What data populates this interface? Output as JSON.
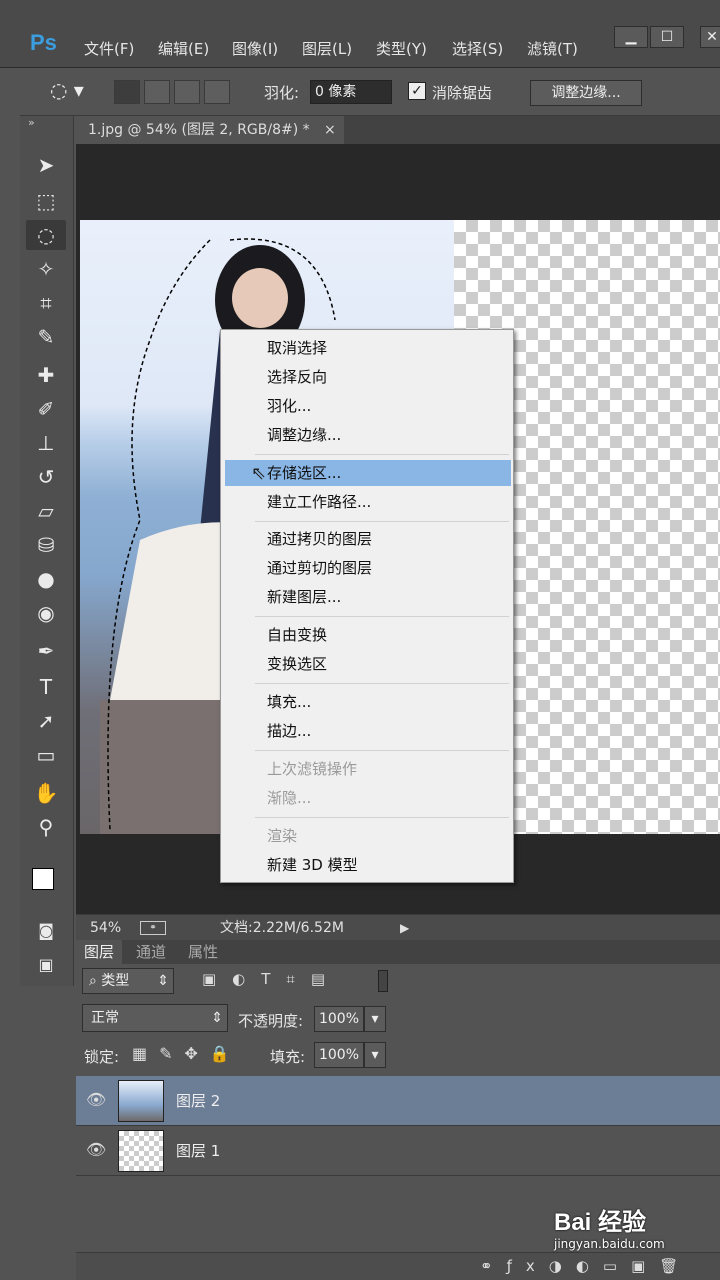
{
  "app": {
    "logo": "Ps"
  },
  "menu": {
    "items": [
      "文件(F)",
      "编辑(E)",
      "图像(I)",
      "图层(L)",
      "类型(Y)",
      "选择(S)",
      "滤镜(T)"
    ],
    "window_buttons": [
      "▁",
      "☐",
      "✕"
    ]
  },
  "options": {
    "feather_label": "羽化:",
    "feather_value": "0 像素",
    "antialias_label": "消除锯齿",
    "antialias_checked": true,
    "refine_edge_label": "调整边缘..."
  },
  "document_tab": {
    "title": "1.jpg @ 54% (图层 2, RGB/8#) *",
    "close": "×"
  },
  "toolbox": {
    "icons": [
      "move-icon",
      "marquee-icon",
      "lasso-icon",
      "magic-wand-icon",
      "crop-icon",
      "eyedropper-icon",
      "healing-brush-icon",
      "brush-icon",
      "clone-stamp-icon",
      "history-brush-icon",
      "eraser-icon",
      "paint-bucket-icon",
      "blur-icon",
      "dodge-icon",
      "pen-icon",
      "type-icon",
      "path-selection-icon",
      "rectangle-icon",
      "hand-icon",
      "zoom-icon"
    ],
    "active": "lasso-icon"
  },
  "context_menu": {
    "groups": [
      [
        "取消选择",
        "选择反向",
        "羽化...",
        "调整边缘..."
      ],
      [
        "存储选区...",
        "建立工作路径..."
      ],
      [
        "通过拷贝的图层",
        "通过剪切的图层",
        "新建图层..."
      ],
      [
        "自由变换",
        "变换选区"
      ],
      [
        "填充...",
        "描边..."
      ],
      [
        "上次滤镜操作",
        "渐隐..."
      ],
      [
        "渲染",
        "新建 3D 模型"
      ]
    ],
    "highlighted": "存储选区...",
    "disabled": [
      "上次滤镜操作",
      "渐隐...",
      "渲染"
    ]
  },
  "status": {
    "zoom": "54%",
    "doc": "文档:2.22M/6.52M"
  },
  "layers_panel": {
    "tabs": [
      "图层",
      "通道",
      "属性"
    ],
    "filter_label": "类型",
    "blend_mode": "正常",
    "opacity_label": "不透明度:",
    "opacity_value": "100%",
    "lock_label": "锁定:",
    "fill_label": "填充:",
    "fill_value": "100%",
    "layers": [
      {
        "name": "图层 2",
        "selected": true
      },
      {
        "name": "图层 1",
        "selected": false
      }
    ]
  },
  "watermark": {
    "brand": "Bai 经验",
    "url": "jingyan.baidu.com"
  },
  "colors": {
    "accent_selection": "#8ab6e6",
    "ps_blue": "#3b9ddd"
  }
}
